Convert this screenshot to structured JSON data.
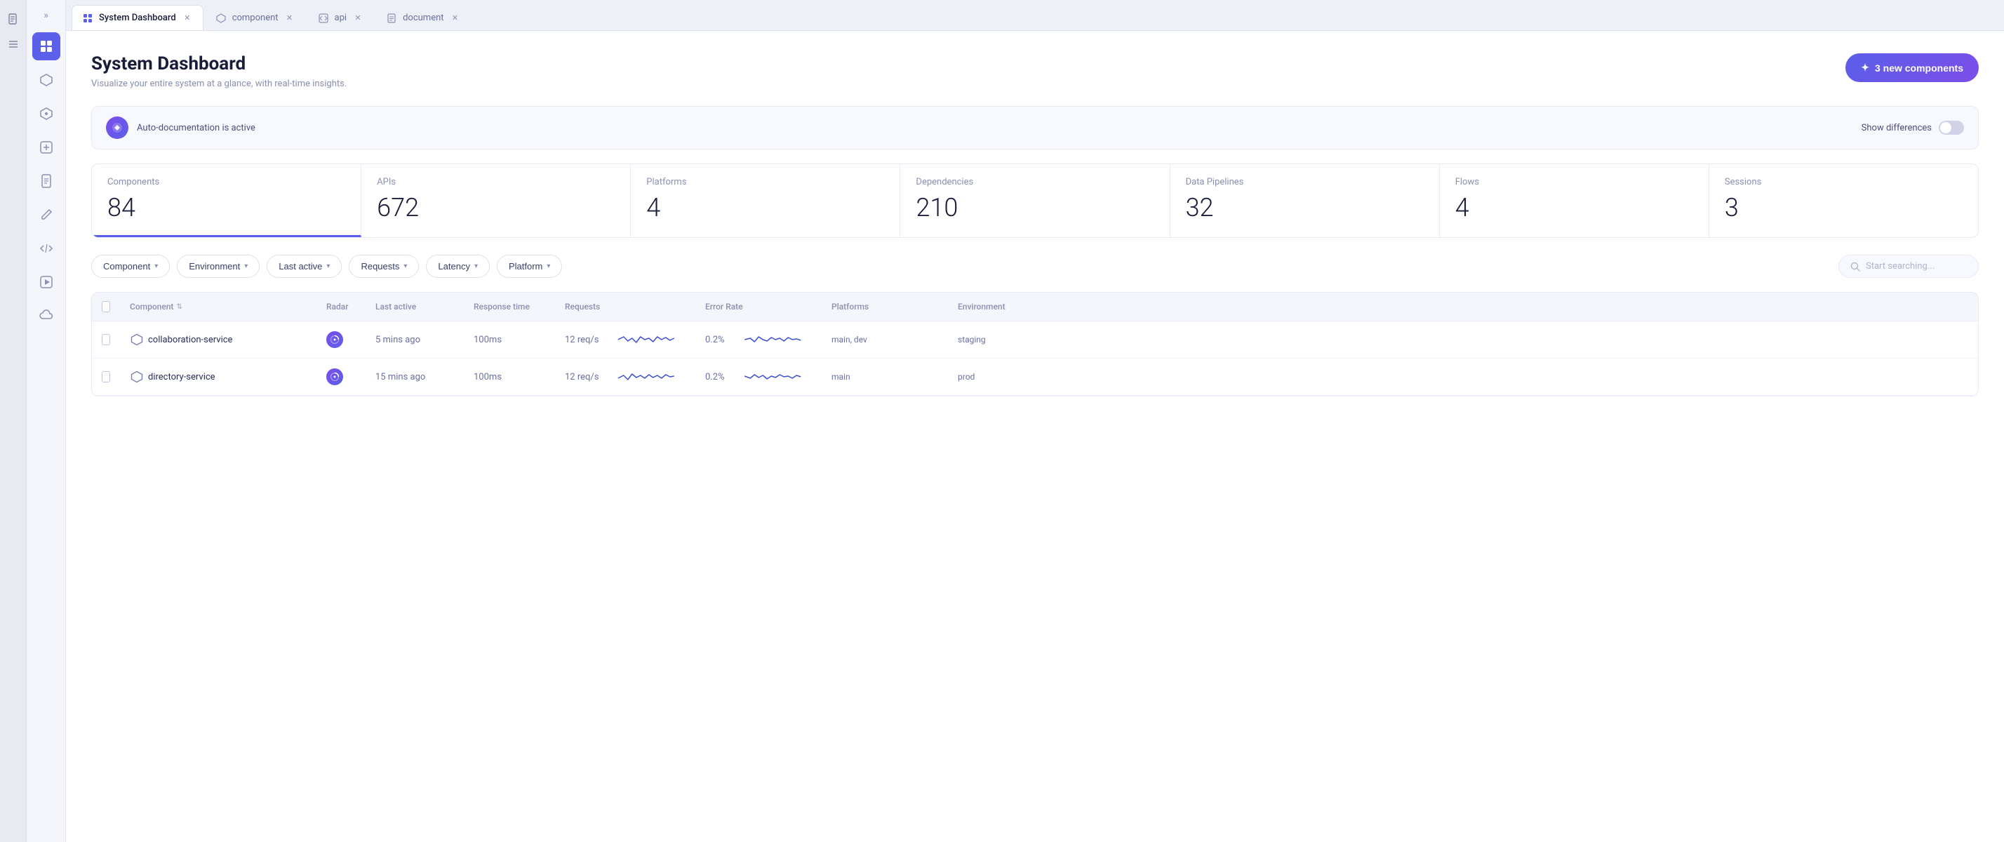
{
  "app": {
    "title": "System Dashboard"
  },
  "icon_strip": {
    "items": [
      "📄",
      "≡"
    ]
  },
  "sidebar": {
    "chevron": "»",
    "items": [
      {
        "id": "dashboard",
        "label": "Dashboard",
        "icon": "⊞",
        "active": true
      },
      {
        "id": "component",
        "label": "Component",
        "icon": "⬡"
      },
      {
        "id": "hex2",
        "label": "Hex2",
        "icon": "⬡"
      },
      {
        "id": "plus-box",
        "label": "Plus Box",
        "icon": "⊞"
      },
      {
        "id": "document",
        "label": "Document",
        "icon": "▤"
      },
      {
        "id": "edit",
        "label": "Edit",
        "icon": "✎"
      },
      {
        "id": "code",
        "label": "Code",
        "icon": "<>"
      },
      {
        "id": "play",
        "label": "Play",
        "icon": "▶"
      },
      {
        "id": "cloud",
        "label": "Cloud",
        "icon": "☁"
      }
    ]
  },
  "tabs": [
    {
      "id": "system-dashboard",
      "label": "System Dashboard",
      "icon": "⊞",
      "active": true
    },
    {
      "id": "component",
      "label": "component",
      "icon": "⬡",
      "active": false
    },
    {
      "id": "api",
      "label": "api",
      "icon": "⊕",
      "active": false
    },
    {
      "id": "document",
      "label": "document",
      "icon": "▤",
      "active": false
    }
  ],
  "page": {
    "title": "System Dashboard",
    "subtitle": "Visualize your entire system at a glance, with real-time insights.",
    "new_components_btn": "3 new components"
  },
  "autodoc": {
    "text": "Auto-documentation is active",
    "show_differences_label": "Show differences"
  },
  "stats": [
    {
      "label": "Components",
      "value": "84",
      "active": true
    },
    {
      "label": "APIs",
      "value": "672",
      "active": false
    },
    {
      "label": "Platforms",
      "value": "4",
      "active": false
    },
    {
      "label": "Dependencies",
      "value": "210",
      "active": false
    },
    {
      "label": "Data Pipelines",
      "value": "32",
      "active": false
    },
    {
      "label": "Flows",
      "value": "4",
      "active": false
    },
    {
      "label": "Sessions",
      "value": "3",
      "active": false
    }
  ],
  "filters": [
    {
      "id": "component",
      "label": "Component"
    },
    {
      "id": "environment",
      "label": "Environment"
    },
    {
      "id": "last-active",
      "label": "Last active"
    },
    {
      "id": "requests",
      "label": "Requests"
    },
    {
      "id": "latency",
      "label": "Latency"
    },
    {
      "id": "platform",
      "label": "Platform"
    }
  ],
  "search": {
    "placeholder": "Start searching..."
  },
  "table": {
    "headers": [
      "",
      "Component",
      "Radar",
      "Last active",
      "Response time",
      "Requests",
      "Error Rate",
      "Platforms",
      "Environment"
    ],
    "rows": [
      {
        "name": "collaboration-service",
        "radar": true,
        "last_active": "5 mins ago",
        "response_time": "100ms",
        "requests": "12 req/s",
        "error_rate": "0.2%",
        "platforms": "main, dev",
        "environment": "staging"
      },
      {
        "name": "directory-service",
        "radar": true,
        "last_active": "15 mins ago",
        "response_time": "100ms",
        "requests": "12 req/s",
        "error_rate": "0.2%",
        "platforms": "main",
        "environment": "prod"
      }
    ]
  },
  "colors": {
    "accent": "#5b5fea",
    "accent2": "#7c4de8",
    "sparkline_requests": "#3b4fd0",
    "sparkline_errors": "#3b4fd0"
  }
}
